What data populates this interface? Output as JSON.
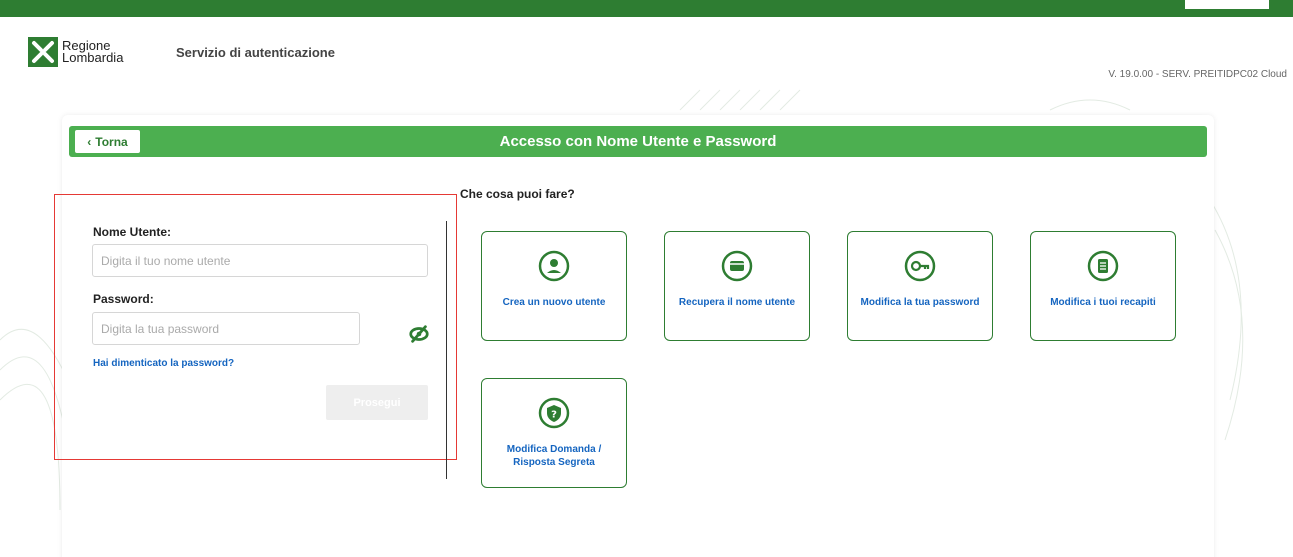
{
  "header": {
    "brand_line1": "Regione",
    "brand_line2": "Lombardia",
    "service_title": "Servizio di autenticazione",
    "version": "V. 19.0.00 - SERV. PREITIDPC02 Cloud"
  },
  "card": {
    "back_label": "Torna",
    "title": "Accesso con Nome Utente e Password"
  },
  "login": {
    "username_label": "Nome Utente:",
    "username_placeholder": "Digita il tuo nome utente",
    "username_value": "",
    "password_label": "Password:",
    "password_placeholder": "Digita la tua password",
    "password_value": "",
    "forgot_label": "Hai dimenticato la password?",
    "submit_label": "Prosegui"
  },
  "actions": {
    "title": "Che cosa puoi fare?",
    "items": [
      {
        "label": "Crea un nuovo utente",
        "icon": "user-icon"
      },
      {
        "label": "Recupera il nome utente",
        "icon": "card-icon"
      },
      {
        "label": "Modifica la tua password",
        "icon": "key-icon"
      },
      {
        "label": "Modifica i tuoi recapiti",
        "icon": "document-icon"
      },
      {
        "label": "Modifica Domanda / Risposta Segreta",
        "icon": "shield-question-icon"
      }
    ]
  },
  "colors": {
    "brand_green": "#2e7d32",
    "header_green": "#4caf50",
    "link_blue": "#1565c0",
    "highlight_red": "#e53935"
  }
}
